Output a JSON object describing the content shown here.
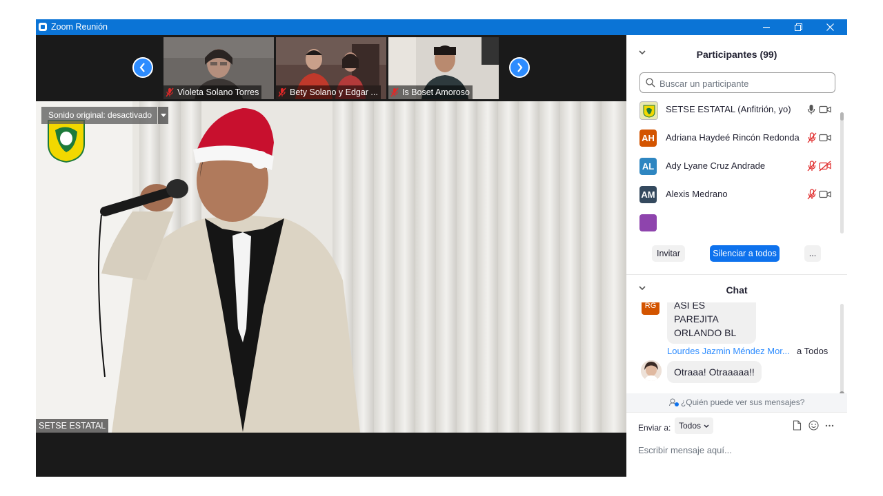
{
  "window": {
    "title": "Zoom Reunión"
  },
  "strip": {
    "thumbnails": [
      {
        "name": "Violeta Solano Torres"
      },
      {
        "name": "Bety Solano y Edgar ..."
      },
      {
        "name": "Is Boset Amoroso"
      }
    ]
  },
  "main_video": {
    "original_sound": "Sonido original: desactivado",
    "speaker_name": "SETSE ESTATAL"
  },
  "participants": {
    "title": "Participantes (99)",
    "search_placeholder": "Buscar un participante",
    "list": [
      {
        "initials": "",
        "name": "SETSE ESTATAL (Anfitrión, yo)",
        "color": "#e8e8b0",
        "mic": "on",
        "video": "on"
      },
      {
        "initials": "AH",
        "name": "Adriana Haydeé Rincón Redonda",
        "color": "#d35400",
        "mic": "muted",
        "video": "on"
      },
      {
        "initials": "AL",
        "name": "Ady Lyane Cruz Andrade",
        "color": "#2e86c1",
        "mic": "muted",
        "video": "off"
      },
      {
        "initials": "AM",
        "name": "Alexis Medrano",
        "color": "#34495e",
        "mic": "muted",
        "video": "on"
      }
    ],
    "buttons": {
      "invite": "Invitar",
      "mute_all": "Silenciar a todos",
      "more": "..."
    }
  },
  "chat": {
    "title": "Chat",
    "messages": [
      {
        "avatar": "RG",
        "text_line1": "ASI ES PAREJITA",
        "text_line2": "ORLANDO BL"
      },
      {
        "sender": "Lourdes Jazmin Méndez Mor...",
        "to": "a Todos",
        "text": "Otraaa! Otraaaaa!!"
      }
    ],
    "who_can_see": "¿Quién puede ver sus mensajes?",
    "send_to_label": "Enviar a:",
    "send_to_value": "Todos",
    "compose_placeholder": "Escribir mensaje aquí..."
  },
  "colors": {
    "accent": "#0e72ed",
    "titlebar": "#0b74d6",
    "nav": "#2d8cff",
    "mute": "#e02828"
  }
}
